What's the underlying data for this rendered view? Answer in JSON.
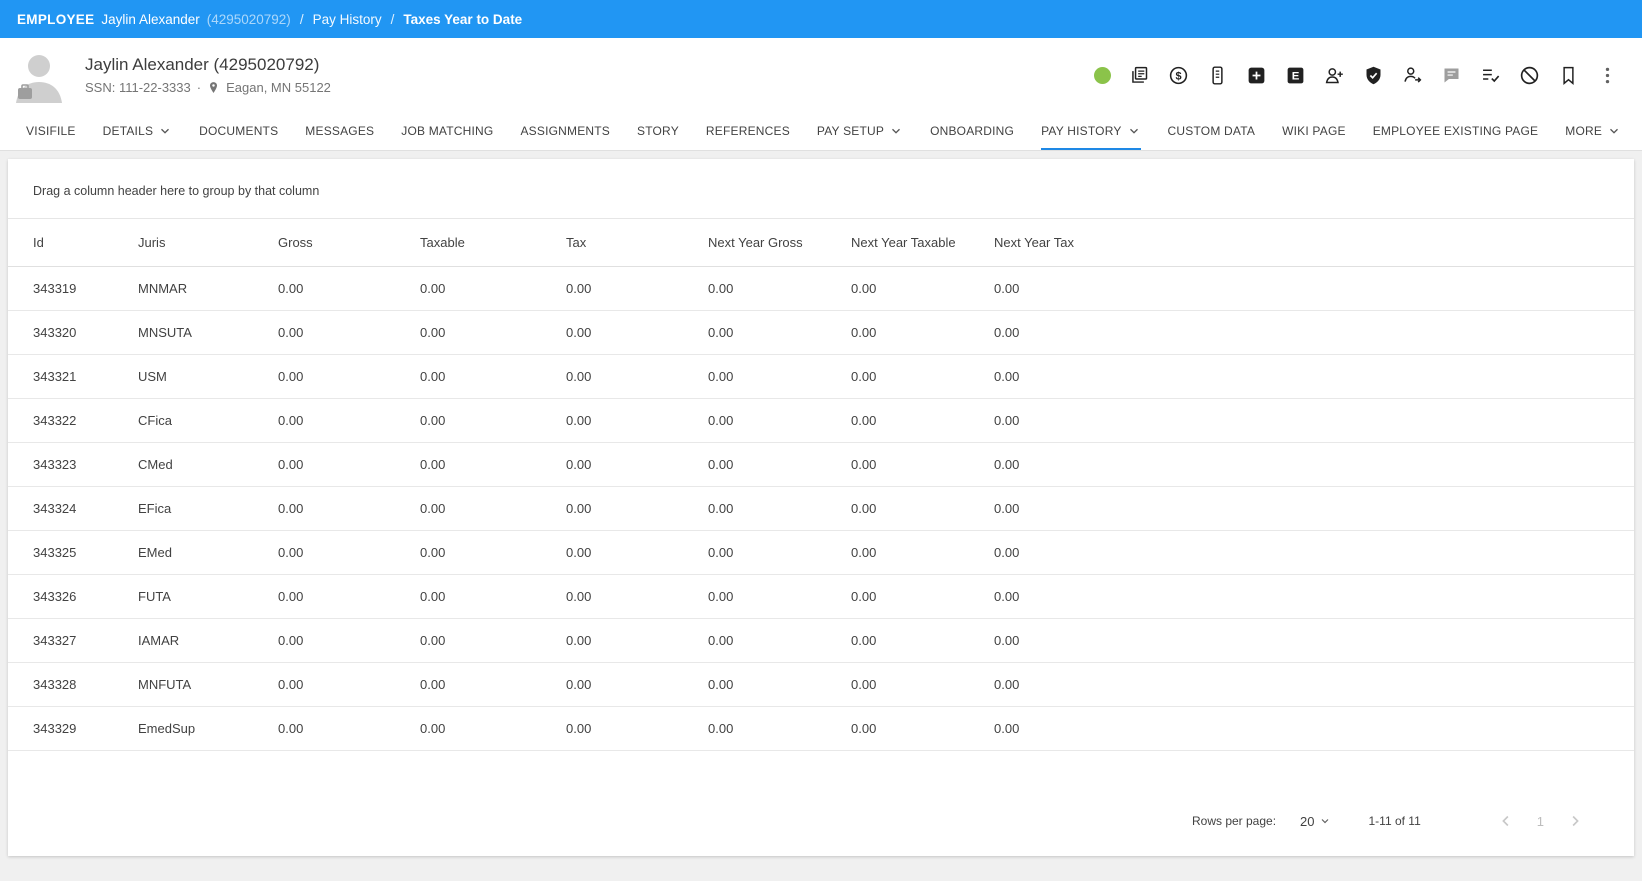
{
  "breadcrumb": {
    "section": "EMPLOYEE",
    "name": "Jaylin Alexander",
    "employee_id": "(4295020792)",
    "separator": "/",
    "parent": "Pay History",
    "current": "Taxes Year to Date"
  },
  "header": {
    "title": "Jaylin Alexander (4295020792)",
    "ssn": "SSN: 111-22-3333",
    "separator": "·",
    "location": "Eagan, MN 55122",
    "status_color": "#8bc34a",
    "toolbar_icons": [
      "activity-log-icon",
      "dollar-circle-icon",
      "clipboard-icon",
      "plus-square-icon",
      "e-square-icon",
      "person-add-icon",
      "shield-check-icon",
      "person-assignment-icon",
      "chat-icon",
      "task-check-icon",
      "block-icon",
      "bookmark-icon",
      "kebab-menu-icon"
    ]
  },
  "tabs": [
    {
      "label": "VISIFILE"
    },
    {
      "label": "DETAILS"
    },
    {
      "label": "DOCUMENTS"
    },
    {
      "label": "MESSAGES"
    },
    {
      "label": "JOB MATCHING"
    },
    {
      "label": "ASSIGNMENTS"
    },
    {
      "label": "STORY"
    },
    {
      "label": "REFERENCES"
    },
    {
      "label": "PAY SETUP"
    },
    {
      "label": "ONBOARDING"
    },
    {
      "label": "PAY HISTORY"
    },
    {
      "label": "CUSTOM DATA"
    },
    {
      "label": "WIKI PAGE"
    },
    {
      "label": "EMPLOYEE EXISTING PAGE"
    },
    {
      "label": "MORE"
    }
  ],
  "grid": {
    "group_hint": "Drag a column header here to group by that column",
    "columns": [
      "Id",
      "Juris",
      "Gross",
      "Taxable",
      "Tax",
      "Next Year Gross",
      "Next Year Taxable",
      "Next Year Tax"
    ],
    "rows": [
      [
        "343319",
        "MNMAR",
        "0.00",
        "0.00",
        "0.00",
        "0.00",
        "0.00",
        "0.00"
      ],
      [
        "343320",
        "MNSUTA",
        "0.00",
        "0.00",
        "0.00",
        "0.00",
        "0.00",
        "0.00"
      ],
      [
        "343321",
        "USM",
        "0.00",
        "0.00",
        "0.00",
        "0.00",
        "0.00",
        "0.00"
      ],
      [
        "343322",
        "CFica",
        "0.00",
        "0.00",
        "0.00",
        "0.00",
        "0.00",
        "0.00"
      ],
      [
        "343323",
        "CMed",
        "0.00",
        "0.00",
        "0.00",
        "0.00",
        "0.00",
        "0.00"
      ],
      [
        "343324",
        "EFica",
        "0.00",
        "0.00",
        "0.00",
        "0.00",
        "0.00",
        "0.00"
      ],
      [
        "343325",
        "EMed",
        "0.00",
        "0.00",
        "0.00",
        "0.00",
        "0.00",
        "0.00"
      ],
      [
        "343326",
        "FUTA",
        "0.00",
        "0.00",
        "0.00",
        "0.00",
        "0.00",
        "0.00"
      ],
      [
        "343327",
        "IAMAR",
        "0.00",
        "0.00",
        "0.00",
        "0.00",
        "0.00",
        "0.00"
      ],
      [
        "343328",
        "MNFUTA",
        "0.00",
        "0.00",
        "0.00",
        "0.00",
        "0.00",
        "0.00"
      ],
      [
        "343329",
        "EmedSup",
        "0.00",
        "0.00",
        "0.00",
        "0.00",
        "0.00",
        "0.00"
      ]
    ]
  },
  "pagination": {
    "rows_per_page_label": "Rows per page:",
    "rows_per_page_value": "20",
    "range": "1-11 of 11",
    "page": "1"
  }
}
